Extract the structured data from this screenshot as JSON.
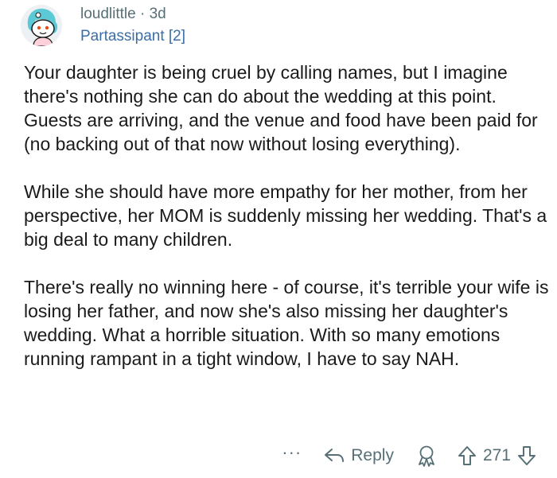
{
  "comment": {
    "username": "loudlittle",
    "separator": "·",
    "age": "3d",
    "flair": "Partassipant [2]",
    "paragraphs": [
      "Your daughter is being cruel by calling names, but I imagine there's nothing she can do about the wedding at this point. Guests are arriving, and the venue and food have been paid for (no backing out of that now without losing everything).",
      "While she should have more empathy for her mother, from her perspective, her MOM is suddenly missing her wedding. That's a big deal to many children.",
      "There's really no winning here - of course, it's terrible your wife is losing her father, and now she's also missing her daughter's wedding. What a horrible situation. With so many emotions running rampant in a tight window, I have to say NAH."
    ]
  },
  "actions": {
    "more_label": "···",
    "reply_label": "Reply",
    "score": "271"
  },
  "icons": {
    "more": "more-options-icon",
    "reply": "reply-arrow-icon",
    "award": "award-icon",
    "upvote": "upvote-arrow-icon",
    "downvote": "downvote-arrow-icon",
    "avatar": "snoo-avatar"
  },
  "colors": {
    "meta_text": "#576f76",
    "flair_text": "#3b6ea8",
    "body_text": "#1a1a1b",
    "avatar_hair": "#5cc9d6"
  }
}
